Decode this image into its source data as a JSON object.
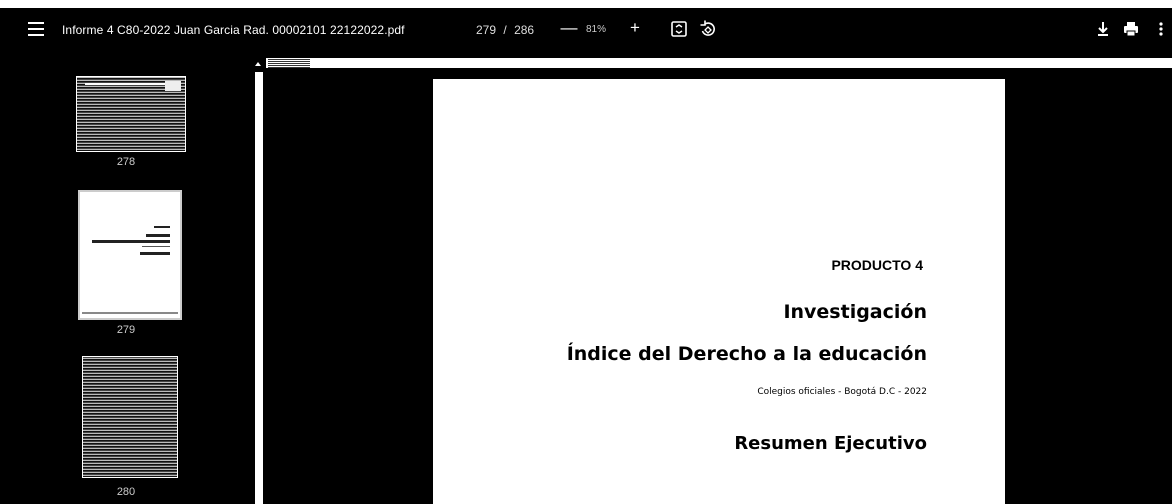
{
  "toolbar": {
    "title": "Informe 4 C80-2022 Juan Garcia Rad. 00002101 22122022.pdf",
    "current_page": "279",
    "page_separator": "/",
    "total_pages": "286",
    "zoom_out_label": "—",
    "zoom_level": "81%",
    "zoom_in_label": "+",
    "icons": [
      "menu-icon",
      "fit-page-icon",
      "rotate-icon",
      "download-icon",
      "print-icon",
      "more-vert-icon"
    ]
  },
  "sidebar": {
    "thumbnails": [
      {
        "page": "278"
      },
      {
        "page": "279"
      },
      {
        "page": "280"
      }
    ]
  },
  "document": {
    "product": "PRODUCTO 4",
    "heading": "Investigación",
    "index_title": "Índice del Derecho a la educación",
    "subtitle": "Colegios oficiales - Bogotá D.C - 2022",
    "summary": "Resumen Ejecutivo"
  },
  "colors": {
    "toolbar_bg": "#000000",
    "viewer_bg": "#000000",
    "page_bg": "#ffffff",
    "text": "#ffffff"
  }
}
